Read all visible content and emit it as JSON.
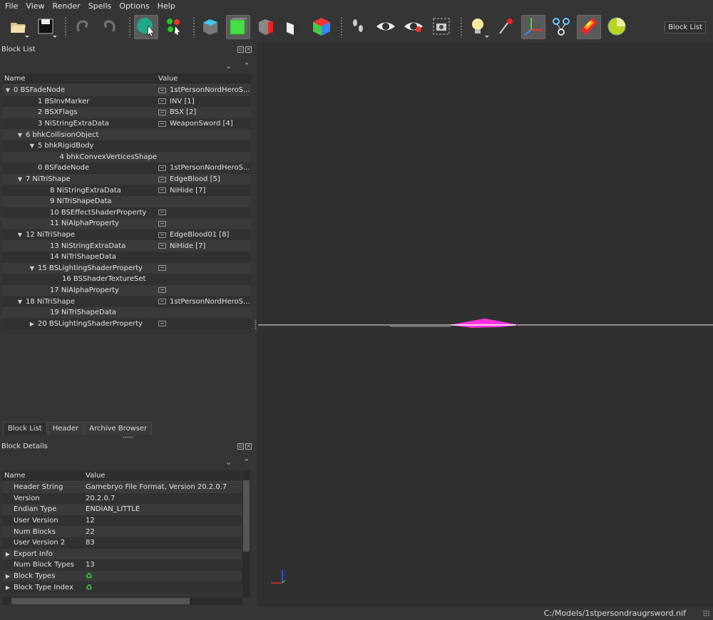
{
  "menu": [
    "File",
    "View",
    "Render",
    "Spells",
    "Options",
    "Help"
  ],
  "toolbar": {
    "buttons": [
      {
        "icon": "open-file-icon",
        "dropdown": true
      },
      {
        "icon": "save-icon",
        "dropdown": true
      },
      {
        "icon": "undo-icon"
      },
      {
        "icon": "redo-icon"
      },
      {
        "icon": "select-object-icon",
        "active": true
      },
      {
        "icon": "select-vertex-icon"
      },
      {
        "icon": "view-top-icon"
      },
      {
        "icon": "view-front-icon",
        "active": true
      },
      {
        "icon": "view-side-icon"
      },
      {
        "icon": "view-user-icon"
      },
      {
        "icon": "view-walk-icon"
      },
      {
        "icon": "footprints-icon"
      },
      {
        "icon": "eye-icon"
      },
      {
        "icon": "eye-hidden-icon"
      },
      {
        "icon": "screenshot-icon"
      },
      {
        "icon": "light-bulb-icon",
        "dropdown": true
      },
      {
        "icon": "show-markers-icon"
      },
      {
        "icon": "show-axes-icon",
        "active": true
      },
      {
        "icon": "show-nodes-icon"
      },
      {
        "icon": "show-textures-icon",
        "active": true
      },
      {
        "icon": "show-collision-icon"
      }
    ],
    "overflow": "»",
    "blocklist_label": "Block List"
  },
  "block_list": {
    "title": "Block List",
    "columns": [
      "Name",
      "Value"
    ],
    "rows": [
      {
        "indent": 0,
        "arrow": "open",
        "name": "0 BSFadeNode",
        "tag": true,
        "value": "1stPersonNordHeroS..."
      },
      {
        "indent": 2,
        "arrow": "none",
        "name": "1 BSInvMarker",
        "tag": true,
        "value": "INV [1]"
      },
      {
        "indent": 2,
        "arrow": "none",
        "name": "2 BSXFlags",
        "tag": true,
        "value": "BSX [2]"
      },
      {
        "indent": 2,
        "arrow": "none",
        "name": "3 NiStringExtraData",
        "tag": true,
        "value": "WeaponSword [4]"
      },
      {
        "indent": 1,
        "arrow": "open",
        "name": "6 bhkCollisionObject",
        "tag": false,
        "value": ""
      },
      {
        "indent": 2,
        "arrow": "open",
        "name": "5 bhkRigidBody",
        "tag": false,
        "value": ""
      },
      {
        "indent": 4,
        "arrow": "none",
        "name": "4 bhkConvexVerticesShape",
        "tag": false,
        "value": ""
      },
      {
        "indent": 2,
        "arrow": "none",
        "name": "0 BSFadeNode",
        "tag": true,
        "value": "1stPersonNordHeroS..."
      },
      {
        "indent": 1,
        "arrow": "open",
        "name": "7 NiTriShape",
        "tag": true,
        "value": "EdgeBlood [5]"
      },
      {
        "indent": 3,
        "arrow": "none",
        "name": "8 NiStringExtraData",
        "tag": true,
        "value": "NiHide [7]"
      },
      {
        "indent": 3,
        "arrow": "none",
        "name": "9 NiTriShapeData",
        "tag": false,
        "value": ""
      },
      {
        "indent": 3,
        "arrow": "none",
        "name": "10 BSEffectShaderProperty",
        "tag": true,
        "value": ""
      },
      {
        "indent": 3,
        "arrow": "none",
        "name": "11 NiAlphaProperty",
        "tag": true,
        "value": ""
      },
      {
        "indent": 1,
        "arrow": "open",
        "name": "12 NiTriShape",
        "tag": true,
        "value": "EdgeBlood01 [8]"
      },
      {
        "indent": 3,
        "arrow": "none",
        "name": "13 NiStringExtraData",
        "tag": true,
        "value": "NiHide [7]"
      },
      {
        "indent": 3,
        "arrow": "none",
        "name": "14 NiTriShapeData",
        "tag": false,
        "value": ""
      },
      {
        "indent": 2,
        "arrow": "open",
        "name": "15 BSLightingShaderProperty",
        "tag": true,
        "value": ""
      },
      {
        "indent": 4,
        "arrow": "none",
        "name": "16 BSShaderTextureSet",
        "tag": false,
        "value": ""
      },
      {
        "indent": 3,
        "arrow": "none",
        "name": "17 NiAlphaProperty",
        "tag": true,
        "value": ""
      },
      {
        "indent": 1,
        "arrow": "open",
        "name": "18 NiTriShape",
        "tag": true,
        "value": "1stPersonNordHeroS..."
      },
      {
        "indent": 3,
        "arrow": "none",
        "name": "19 NiTriShapeData",
        "tag": false,
        "value": ""
      },
      {
        "indent": 2,
        "arrow": "closed",
        "name": "20 BSLightingShaderProperty",
        "tag": true,
        "value": ""
      }
    ]
  },
  "tabs": [
    "Block List",
    "Header",
    "Archive Browser"
  ],
  "block_details": {
    "title": "Block Details",
    "columns": [
      "Name",
      "Value"
    ],
    "rows": [
      {
        "arrow": "none",
        "name": "Header String",
        "value": "Gamebryo File Format, Version 20.2.0.7"
      },
      {
        "arrow": "none",
        "name": "Version",
        "value": "20.2.0.7"
      },
      {
        "arrow": "none",
        "name": "Endian Type",
        "value": "ENDIAN_LITTLE"
      },
      {
        "arrow": "none",
        "name": "User Version",
        "value": "12"
      },
      {
        "arrow": "none",
        "name": "Num Blocks",
        "value": "22"
      },
      {
        "arrow": "none",
        "name": "User Version 2",
        "value": "83"
      },
      {
        "arrow": "closed",
        "name": "Export Info",
        "value": ""
      },
      {
        "arrow": "none",
        "name": "Num Block Types",
        "value": "13"
      },
      {
        "arrow": "closed",
        "name": "Block Types",
        "value": "",
        "refresh": true
      },
      {
        "arrow": "closed",
        "name": "Block Type Index",
        "value": "",
        "refresh": true
      }
    ]
  },
  "status": {
    "path": "C:/Models/1stpersondraugrsword.nif"
  },
  "colors": {
    "mesh": "#ff33dd",
    "background": "#303030",
    "panel": "#353535"
  }
}
